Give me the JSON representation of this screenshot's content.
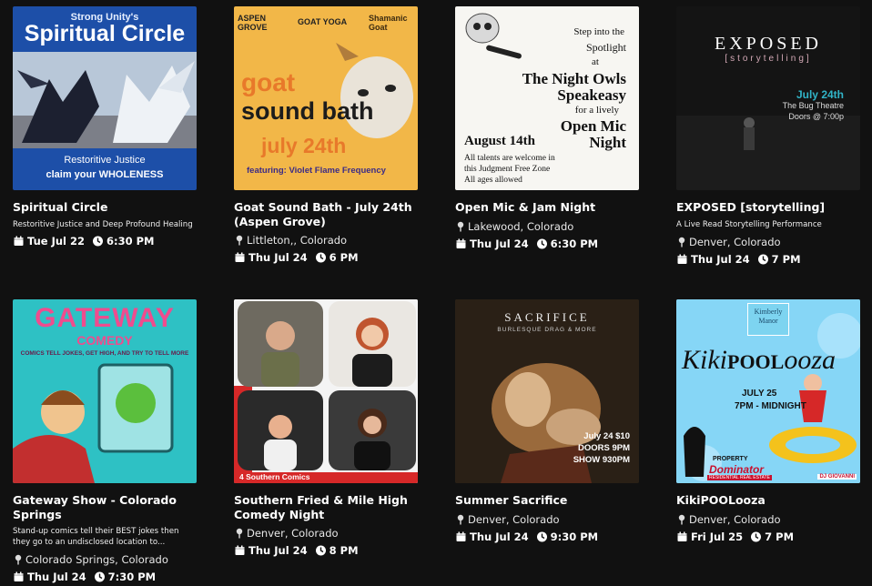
{
  "events": [
    {
      "title": "Spiritual Circle",
      "description": "Restoritive Justice and Deep Profound Healing",
      "location": "",
      "date": "Tue Jul 22",
      "time": "6:30 PM",
      "poster": {
        "top": "Strong Unity's",
        "headline": "Spiritual Circle",
        "bottom1": "Restoritive Justice",
        "bottom2": "claim your WHOLENESS"
      }
    },
    {
      "title": "Goat Sound Bath - July 24th (Aspen Grove)",
      "description": "",
      "location": "Littleton,, Colorado",
      "date": "Thu Jul 24",
      "time": "6 PM",
      "poster": {
        "logo1": "ASPEN GROVE",
        "logo2": "GOAT YOGA",
        "logo3": "Shamanic Goat",
        "line1": "goat",
        "line2": "sound bath",
        "line3": "july 24th",
        "feat": "featuring: Violet Flame Frequency"
      }
    },
    {
      "title": "Open Mic & Jam Night",
      "description": "",
      "location": "Lakewood, Colorado",
      "date": "Thu Jul 24",
      "time": "6:30 PM",
      "poster": {
        "l1": "Step into the",
        "l2": "Spotlight",
        "l3": "at",
        "l4": "The Night Owls",
        "l5": "Speakeasy",
        "l6": "for a lively",
        "l7": "Open Mic",
        "l8": "Night",
        "l9": "August 14th",
        "l10": "All talents are welcome in",
        "l11": "this Judgment Free Zone",
        "l12": "All ages allowed"
      }
    },
    {
      "title": "EXPOSED [storytelling]",
      "description": "A Live Read Storytelling Performance",
      "location": "Denver, Colorado",
      "date": "Thu Jul 24",
      "time": "7 PM",
      "poster": {
        "head": "EXPOSED",
        "sub": "[storytelling]",
        "date": "July 24th",
        "venue": "The Bug Theatre",
        "doors": "Doors @ 7:00p"
      }
    },
    {
      "title": "Gateway Show - Colorado Springs",
      "description": "Stand-up comics tell their BEST jokes then they go to an undisclosed location to...",
      "location": "Colorado Springs, Colorado",
      "date": "Thu Jul 24",
      "time": "7:30 PM",
      "poster": {
        "head": "GATEWAY",
        "sub": "COMEDY",
        "tag": "COMICS TELL JOKES, GET HIGH, AND TRY TO TELL MORE"
      }
    },
    {
      "title": "Southern Fried & Mile High Comedy Night",
      "description": "",
      "location": "Denver, Colorado",
      "date": "Thu Jul 24",
      "time": "8 PM",
      "poster": {
        "banner": "4 Southern Comics"
      }
    },
    {
      "title": "Summer Sacrifice",
      "description": "",
      "location": "Denver, Colorado",
      "date": "Thu Jul 24",
      "time": "9:30 PM",
      "poster": {
        "head": "SACRIFICE",
        "sub": "BURLESQUE DRAG & MORE",
        "l1": "July 24 $10",
        "l2": "DOORS 9PM",
        "l3": "SHOW 930PM"
      }
    },
    {
      "title": "KikiPOOLooza",
      "description": "",
      "location": "Denver, Colorado",
      "date": "Fri Jul 25",
      "time": "7 PM",
      "poster": {
        "badge": "Kimberly Manor",
        "head1": "Kiki",
        "head2": "POOL",
        "head3": "ooza",
        "date": "JULY 25",
        "hours": "7PM - MIDNIGHT",
        "sponsor1": "PROPERTY",
        "sponsor2": "Dominator",
        "sponsor3": "RESIDENTIAL REAL ESTATE",
        "dj": "DJ GIOVANNI"
      }
    }
  ]
}
